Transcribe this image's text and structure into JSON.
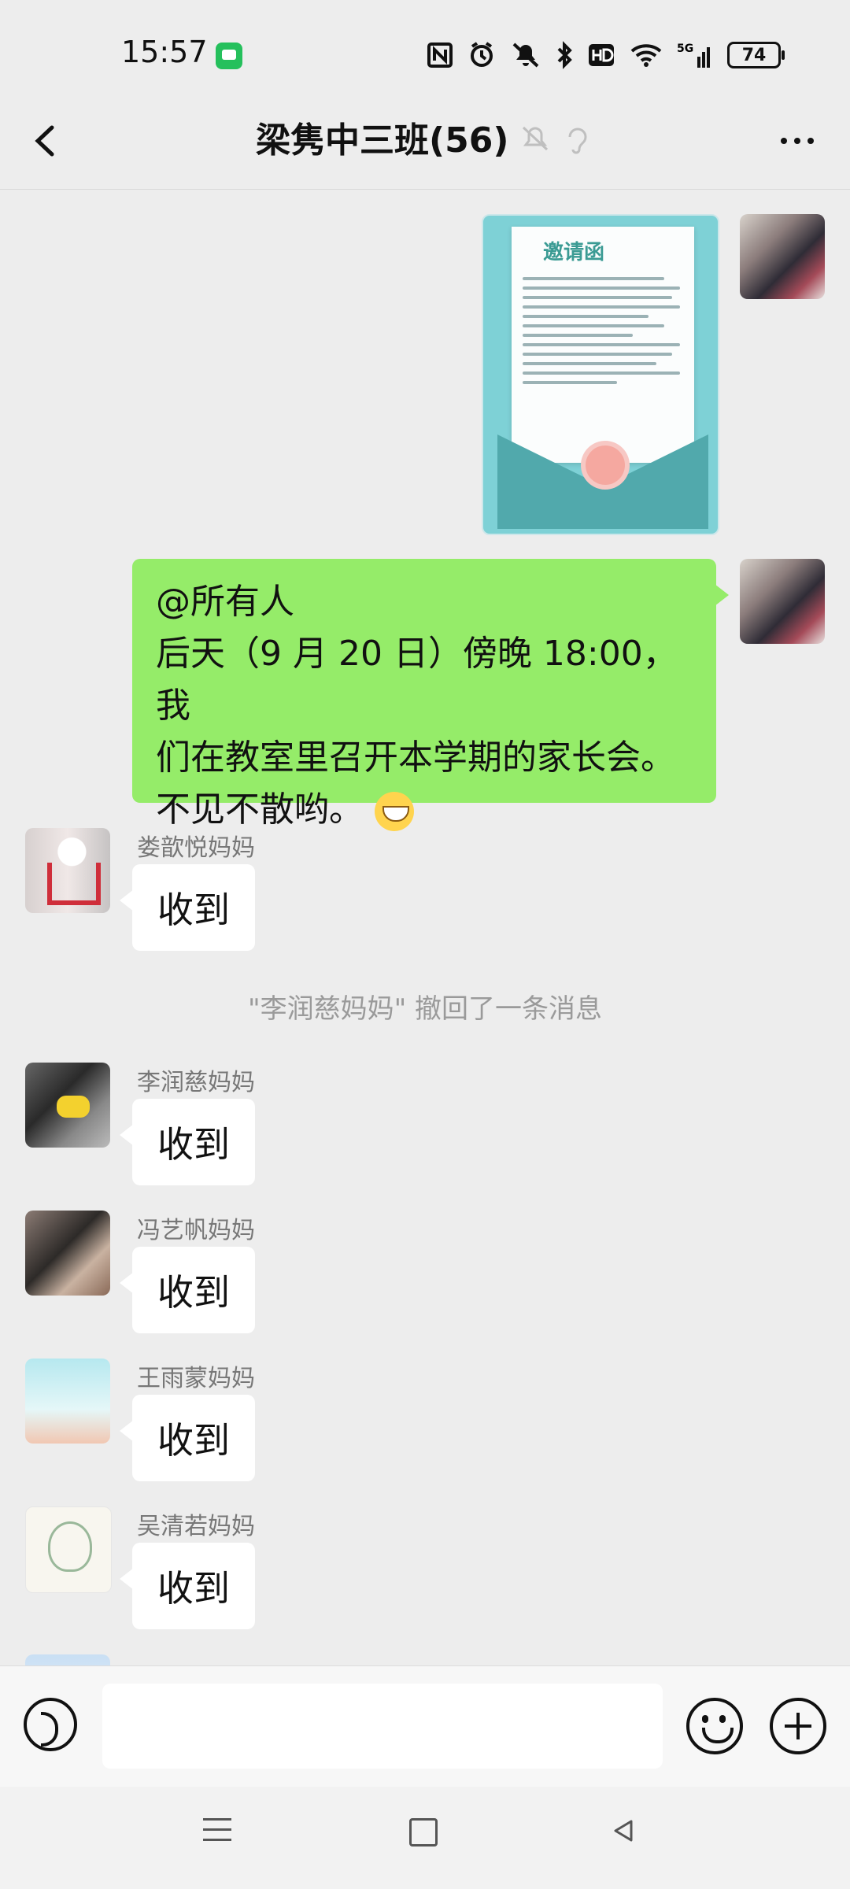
{
  "status_bar": {
    "time": "15:57",
    "battery": "74",
    "icons": [
      "chat-notification-icon",
      "nfc-icon",
      "alarm-icon",
      "silent-icon",
      "bluetooth-icon",
      "hd-icon",
      "wifi-icon",
      "5g-signal-icon",
      "battery-icon"
    ]
  },
  "header": {
    "title": "梁隽中三班(56)"
  },
  "chat": {
    "message_1": {
      "type": "image",
      "image_title": "邀请函"
    },
    "message_2": {
      "lines": [
        "@所有人",
        "后天（9 月 20 日）傍晚 18:00，我",
        "们在教室里召开本学期的家长会。",
        "不见不散哟。"
      ]
    },
    "message_3": {
      "sender": "娄歆悦妈妈",
      "text": "收到"
    },
    "system_note": "\"李润慈妈妈\" 撤回了一条消息",
    "message_4": {
      "sender": "李润慈妈妈",
      "text": "收到"
    },
    "message_5": {
      "sender": "冯艺帆妈妈",
      "text": "收到"
    },
    "message_6": {
      "sender": "王雨蒙妈妈",
      "text": "收到"
    },
    "message_7": {
      "sender": "吴清若妈妈",
      "text": "收到"
    }
  },
  "bottom": {
    "input_placeholder": ""
  }
}
